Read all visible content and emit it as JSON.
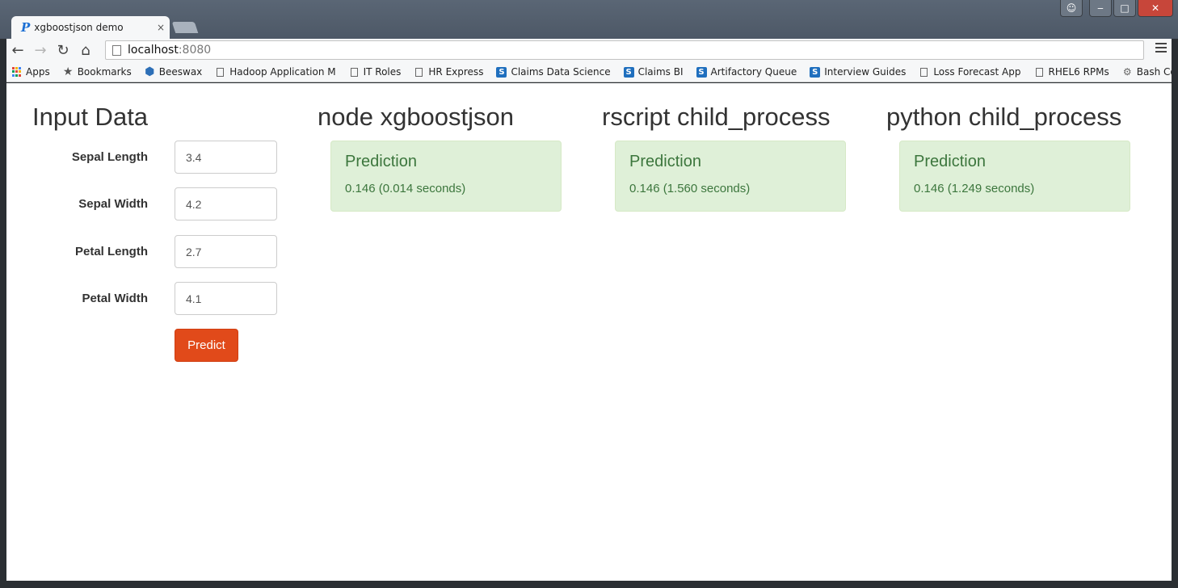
{
  "window": {
    "controls": {
      "user": "☺",
      "minimize": "‒",
      "maximize": "□",
      "close": "✕"
    }
  },
  "tab": {
    "title": "xgboostjson demo",
    "favicon": "P",
    "close": "×"
  },
  "toolbar": {
    "back": "←",
    "forward": "→",
    "reload": "↻",
    "home": "⌂",
    "url_host": "localhost",
    "url_port": ":8080"
  },
  "bookmarks": [
    {
      "label": "Apps",
      "icon": "apps-grid-icon"
    },
    {
      "label": "Bookmarks",
      "icon": "star-icon"
    },
    {
      "label": "Beeswax",
      "icon": "beeswax-icon"
    },
    {
      "label": "Hadoop Application M",
      "icon": "page-icon"
    },
    {
      "label": "IT Roles",
      "icon": "page-icon"
    },
    {
      "label": "HR Express",
      "icon": "page-icon"
    },
    {
      "label": "Claims Data Science",
      "icon": "sharepoint-icon"
    },
    {
      "label": "Claims BI",
      "icon": "sharepoint-icon"
    },
    {
      "label": "Artifactory Queue",
      "icon": "sharepoint-icon"
    },
    {
      "label": "Interview Guides",
      "icon": "sharepoint-icon"
    },
    {
      "label": "Loss Forecast App",
      "icon": "page-icon"
    },
    {
      "label": "RHEL6 RPMs",
      "icon": "page-icon"
    },
    {
      "label": "Bash Conditional Expr",
      "icon": "bash-icon"
    }
  ],
  "input_section": {
    "heading": "Input Data",
    "fields": [
      {
        "label": "Sepal Length",
        "value": "3.4"
      },
      {
        "label": "Sepal Width",
        "value": "4.2"
      },
      {
        "label": "Petal Length",
        "value": "2.7"
      },
      {
        "label": "Petal Width",
        "value": "4.1"
      }
    ],
    "predict_label": "Predict"
  },
  "results": [
    {
      "heading": "node xgboostjson",
      "alert_title": "Prediction",
      "value": "0.146 (0.014 seconds)"
    },
    {
      "heading": "rscript child_process",
      "alert_title": "Prediction",
      "value": "0.146 (1.560 seconds)"
    },
    {
      "heading": "python child_process",
      "alert_title": "Prediction",
      "value": "0.146 (1.249 seconds)"
    }
  ],
  "colors": {
    "primary_button": "#e14a1a",
    "alert_bg": "#dff0d8",
    "alert_text": "#3c763d"
  }
}
